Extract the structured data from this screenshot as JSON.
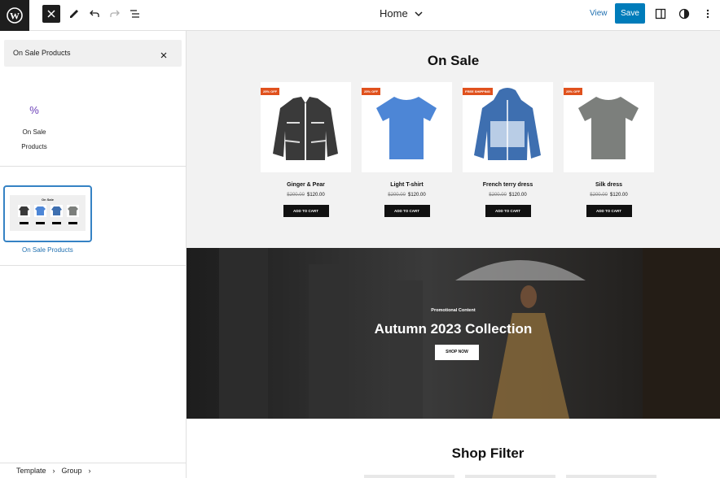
{
  "topbar": {
    "doc_title": "Home",
    "view_label": "View",
    "save_label": "Save"
  },
  "sidebar": {
    "search_value": "On Sale Products",
    "block_result_label": "On Sale Products",
    "block_result_icon": "%",
    "pattern_label": "On Sale Products",
    "pattern_preview_title": "On Sale",
    "breadcrumb": [
      "Template",
      "Group"
    ]
  },
  "canvas": {
    "sale_title": "On Sale",
    "products": [
      {
        "name": "Ginger & Pear",
        "old_price": "$200.00",
        "price": "$120.00",
        "badge": "25% OFF",
        "cart": "ADD TO CART",
        "color": "#3a3a3a"
      },
      {
        "name": "Light T-shirt",
        "old_price": "$200.00",
        "price": "$120.00",
        "badge": "25% OFF",
        "cart": "ADD TO CART",
        "color": "#4d86d6"
      },
      {
        "name": "French terry dress",
        "old_price": "$200.00",
        "price": "$120.00",
        "badge": "FREE SHIPPING",
        "cart": "ADD TO CART",
        "color": "#3e6fb0"
      },
      {
        "name": "Silk dress",
        "old_price": "$200.00",
        "price": "$120.00",
        "badge": "25% OFF",
        "cart": "ADD TO CART",
        "color": "#7c7f7c"
      }
    ],
    "promo": {
      "subtitle": "Promotional Content",
      "heading": "Autumn 2023 Collection",
      "button": "SHOP NOW"
    },
    "filter_title": "Shop Filter"
  },
  "colors": {
    "accent": "#007cba",
    "badge": "#e0511d",
    "selection": "#3582c4"
  }
}
